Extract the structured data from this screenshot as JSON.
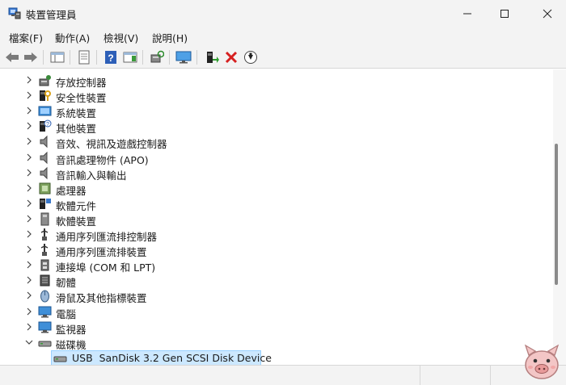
{
  "window": {
    "title": "裝置管理員"
  },
  "menu": [
    {
      "label": "檔案(F)"
    },
    {
      "label": "動作(A)"
    },
    {
      "label": "檢視(V)"
    },
    {
      "label": "說明(H)"
    }
  ],
  "toolbar": {
    "icons": [
      "back-arrow-icon",
      "forward-arrow-icon",
      "show-hide-console-tree-icon",
      "properties-icon",
      "help-icon",
      "action-pane-icon",
      "scan-hardware-icon",
      "monitor-icon",
      "update-driver-icon",
      "uninstall-device-icon",
      "disable-device-icon"
    ]
  },
  "tree": {
    "categories": [
      {
        "label": "存放控制器",
        "icon": "storage-controller-icon"
      },
      {
        "label": "安全性裝置",
        "icon": "security-device-icon"
      },
      {
        "label": "系統裝置",
        "icon": "system-device-icon"
      },
      {
        "label": "其他裝置",
        "icon": "other-device-icon"
      },
      {
        "label": "音效、視訊及遊戲控制器",
        "icon": "sound-icon"
      },
      {
        "label": "音訊處理物件 (APO)",
        "icon": "audio-processing-icon"
      },
      {
        "label": "音訊輸入與輸出",
        "icon": "audio-io-icon"
      },
      {
        "label": "處理器",
        "icon": "processor-icon"
      },
      {
        "label": "軟體元件",
        "icon": "software-component-icon"
      },
      {
        "label": "軟體裝置",
        "icon": "software-device-icon"
      },
      {
        "label": "通用序列匯流排控制器",
        "icon": "usb-controller-icon"
      },
      {
        "label": "通用序列匯流排裝置",
        "icon": "usb-device-icon"
      },
      {
        "label": "連接埠 (COM 和 LPT)",
        "icon": "port-icon"
      },
      {
        "label": "韌體",
        "icon": "firmware-icon"
      },
      {
        "label": "滑鼠及其他指標裝置",
        "icon": "mouse-icon"
      },
      {
        "label": "電腦",
        "icon": "computer-icon"
      },
      {
        "label": "監視器",
        "icon": "monitor-icon"
      },
      {
        "label": "磁碟機",
        "icon": "disk-drive-icon",
        "expanded": true
      }
    ],
    "selected_child": {
      "label": "USB  SanDisk 3.2 Gen SCSI Disk Device",
      "icon": "disk-icon"
    }
  }
}
